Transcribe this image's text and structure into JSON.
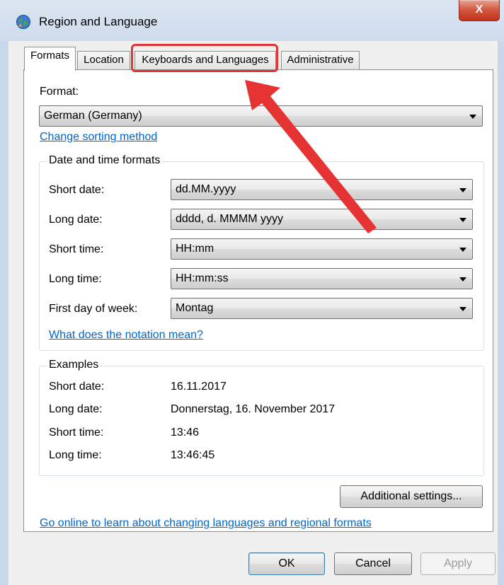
{
  "window": {
    "title": "Region and Language",
    "close_label": "X"
  },
  "tabs": [
    {
      "label": "Formats",
      "active": true
    },
    {
      "label": "Location",
      "active": false
    },
    {
      "label": "Keyboards and Languages",
      "active": false,
      "highlighted": true
    },
    {
      "label": "Administrative",
      "active": false
    }
  ],
  "formats": {
    "format_label": "Format:",
    "format_value": "German (Germany)",
    "change_sorting_link": "Change sorting method",
    "date_time_group": {
      "title": "Date and time formats",
      "rows": [
        {
          "label": "Short date:",
          "value": "dd.MM.yyyy"
        },
        {
          "label": "Long date:",
          "value": "dddd, d. MMMM yyyy"
        },
        {
          "label": "Short time:",
          "value": "HH:mm"
        },
        {
          "label": "Long time:",
          "value": "HH:mm:ss"
        },
        {
          "label": "First day of week:",
          "value": "Montag"
        }
      ],
      "notation_link": "What does the notation mean?"
    },
    "examples_group": {
      "title": "Examples",
      "rows": [
        {
          "label": "Short date:",
          "value": "16.11.2017"
        },
        {
          "label": "Long date:",
          "value": "Donnerstag, 16. November 2017"
        },
        {
          "label": "Short time:",
          "value": "13:46"
        },
        {
          "label": "Long time:",
          "value": "13:46:45"
        }
      ]
    },
    "additional_settings_label": "Additional settings...",
    "online_link": "Go online to learn about changing languages and regional formats"
  },
  "footer": {
    "ok_label": "OK",
    "cancel_label": "Cancel",
    "apply_label": "Apply"
  },
  "colors": {
    "highlight": "#e53232",
    "link": "#0066cc"
  },
  "icons": {
    "app": "globe-icon",
    "annotation": "red-arrow-icon"
  }
}
